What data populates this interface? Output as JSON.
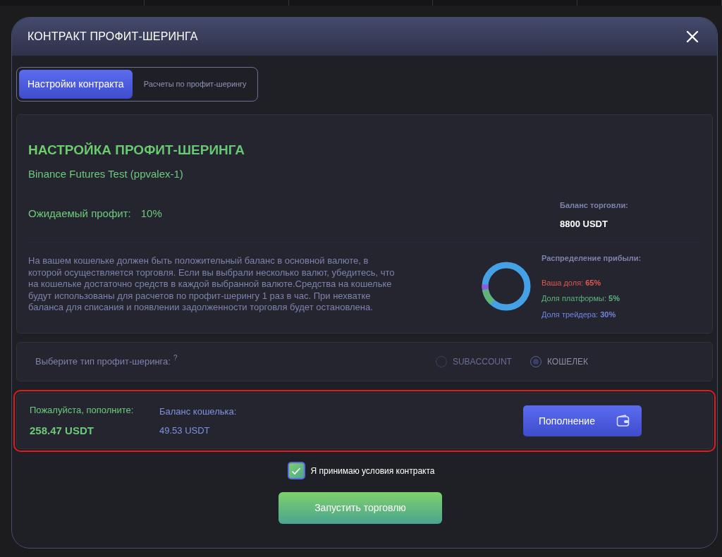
{
  "window": {
    "title": "КОНТРАКТ ПРОФИТ-ШЕРИНГА"
  },
  "tabs": [
    {
      "label": "Настройки контракта",
      "selected": true
    },
    {
      "label": "Расчеты по профит-шерингу",
      "selected": false
    }
  ],
  "settings": {
    "heading": "НАСТРОЙКА ПРОФИТ-ШЕРИНГА",
    "exchange": "Binance Futures Test (ppvalex-1)",
    "expected_profit_label": "Ожидаемый профит:",
    "expected_profit_value": "10%",
    "trade_balance_label": "Баланс торговли:",
    "trade_balance_value": "8800 USDT",
    "notice": "На вашем кошельке должен быть положительный баланс в основной валюте, в которой осуществляется торговля. Если вы выбрали несколько валют, убедитесь, что на кошельке достаточно средств в каждой выбранной валюте.Средства на кошельке будут использованы для расчетов по профит-шерингу 1 раз в час. При нехватке баланса для списания и появлении задолженности торговля будет остановлена.",
    "distribution_label": "Распределение прибыли:",
    "shares": [
      {
        "label": "Ваша доля:",
        "value": "65%",
        "color": "#e0584f"
      },
      {
        "label": "Доля платформы:",
        "value": "5%",
        "color": "#5fb47a"
      },
      {
        "label": "Доля трейдера:",
        "value": "30%",
        "color": "#6f86e0"
      }
    ]
  },
  "sharing_type": {
    "label": "Выберите тип профит-шеринга:",
    "hint": "?",
    "options": [
      {
        "label": "SUBACCOUNT",
        "selected": false,
        "disabled": true
      },
      {
        "label": "КОШЕЛЕК",
        "selected": true,
        "disabled": false
      }
    ]
  },
  "deposit": {
    "highlighted": true,
    "required_label": "Пожалуйста, пополните:",
    "required_value": "258.47 USDT",
    "wallet_label": "Баланс кошелька:",
    "wallet_value": "49.53 USDT",
    "button": "Пополнение"
  },
  "accept": {
    "label": "Я принимаю условия контракта",
    "checked": true
  },
  "start_button": "Запустить торговлю"
}
